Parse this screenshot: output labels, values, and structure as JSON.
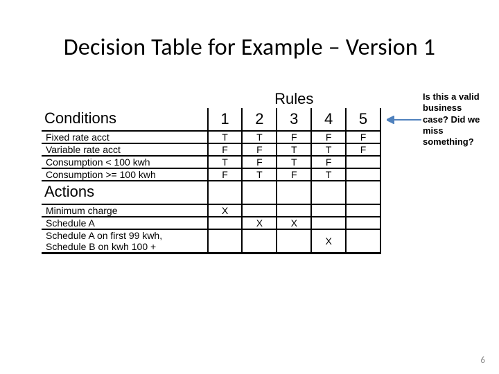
{
  "title": "Decision Table for Example – Version 1",
  "headers": {
    "rules": "Rules",
    "conditions": "Conditions",
    "actions": "Actions"
  },
  "rule_numbers": [
    "1",
    "2",
    "3",
    "4",
    "5"
  ],
  "conditions": [
    {
      "label": "Fixed rate acct",
      "v": [
        "T",
        "T",
        "F",
        "F",
        "F"
      ]
    },
    {
      "label": "Variable rate acct",
      "v": [
        "F",
        "F",
        "T",
        "T",
        "F"
      ]
    },
    {
      "label": "Consumption < 100 kwh",
      "v": [
        "T",
        "F",
        "T",
        "F",
        ""
      ]
    },
    {
      "label": "Consumption >= 100 kwh",
      "v": [
        "F",
        "T",
        "F",
        "T",
        ""
      ]
    }
  ],
  "actions": [
    {
      "label": "Minimum charge",
      "v": [
        "X",
        "",
        "",
        "",
        ""
      ]
    },
    {
      "label": "Schedule A",
      "v": [
        "",
        "X",
        "X",
        "",
        ""
      ]
    },
    {
      "label": "Schedule A on first 99 kwh,\nSchedule B on kwh 100 +",
      "v": [
        "",
        "",
        "",
        "X",
        ""
      ]
    }
  ],
  "annotation": "Is this a valid business case? Did we miss something?",
  "page_number": "6",
  "chart_data": {
    "type": "table",
    "title": "Decision Table for Example – Version 1",
    "rule_columns": [
      1,
      2,
      3,
      4,
      5
    ],
    "conditions": {
      "Fixed rate acct": [
        "T",
        "T",
        "F",
        "F",
        "F"
      ],
      "Variable rate acct": [
        "F",
        "F",
        "T",
        "T",
        "F"
      ],
      "Consumption < 100 kwh": [
        "T",
        "F",
        "T",
        "F",
        null
      ],
      "Consumption >= 100 kwh": [
        "F",
        "T",
        "F",
        "T",
        null
      ]
    },
    "actions": {
      "Minimum charge": [
        "X",
        null,
        null,
        null,
        null
      ],
      "Schedule A": [
        null,
        "X",
        "X",
        null,
        null
      ],
      "Schedule A on first 99 kwh, Schedule B on kwh 100 +": [
        null,
        null,
        null,
        "X",
        null
      ]
    },
    "annotation": "Is this a valid business case? Did we miss something?"
  }
}
